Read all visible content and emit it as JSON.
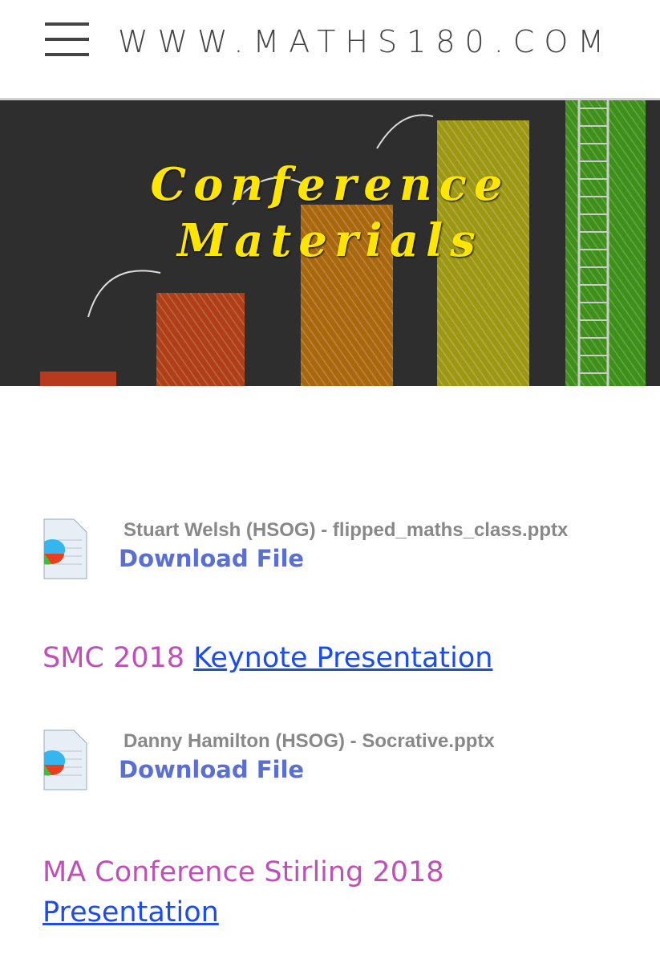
{
  "header": {
    "site_title": "WWW.MATHS180.COM",
    "menu_icon": "hamburger-icon"
  },
  "banner": {
    "title_line1": "Conference",
    "title_line2": "Materials",
    "title_color": "#ffe600"
  },
  "content": {
    "files": [
      {
        "name": "Stuart Welsh (HSOG) - flipped_maths_class.pptx",
        "download_label": "Download File",
        "icon": "presentation-file-icon"
      },
      {
        "name": "Danny Hamilton (HSOG) - Socrative.pptx",
        "download_label": "Download File",
        "icon": "presentation-file-icon"
      }
    ],
    "sections": [
      {
        "text": "SMC 2018",
        "link": "Keynote Presentation"
      },
      {
        "text": "MA Conference Stirling 2018",
        "link": "Presentation"
      }
    ],
    "colors": {
      "heading": "#c050b8",
      "link": "#1a4cf0",
      "download": "#5a6fd6"
    }
  }
}
